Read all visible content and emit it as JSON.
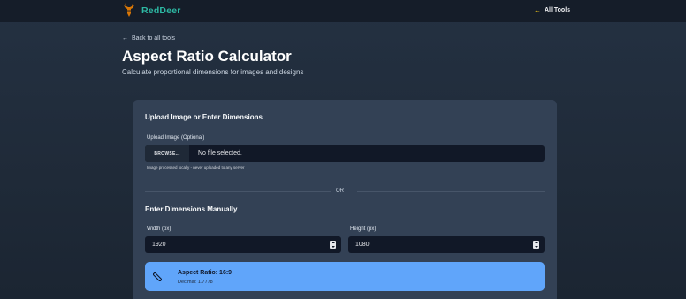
{
  "header": {
    "brand": "RedDeer",
    "all_tools_label": "All Tools"
  },
  "page": {
    "back_label": "Back to all tools",
    "title": "Aspect Ratio Calculator",
    "subtitle": "Calculate proportional dimensions for images and designs"
  },
  "upload": {
    "section_title": "Upload Image or Enter Dimensions",
    "field_label": "Upload Image (Optional)",
    "browse_label": "BROWSE...",
    "file_status": "No file selected.",
    "hint": "Image processed locally - never uploaded to any server"
  },
  "divider_label": "OR",
  "manual": {
    "section_title": "Enter Dimensions Manually",
    "width_label": "Width (px)",
    "width_value": "1920",
    "height_label": "Height (px)",
    "height_value": "1080"
  },
  "result": {
    "ratio_text": "Aspect Ratio: 16:9",
    "decimal_text": "Decimal: 1.7778"
  },
  "icons": {
    "logo": "deer-head-logo",
    "all_tools": "arrow-left-icon",
    "back": "arrow-left-icon",
    "ratio": "ruler-icon"
  },
  "colors": {
    "brand": "#2db8a3",
    "accent": "#facc15",
    "result_bg": "#60a5fa",
    "card_bg": "#334155"
  }
}
